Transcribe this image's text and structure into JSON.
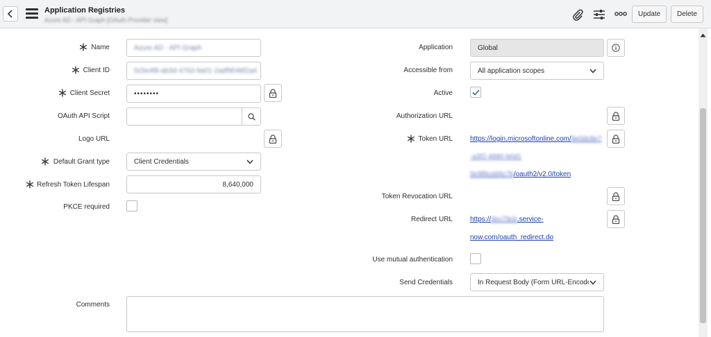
{
  "header": {
    "title": "Application Registries",
    "subtitle": "Azure AD - API Graph [OAuth Provider view]",
    "update_label": "Update",
    "delete_label": "Delete"
  },
  "left": {
    "name_label": "Name",
    "name_value": "Azure AD - API Graph",
    "client_id_label": "Client ID",
    "client_id_value": "0c5e4f8-ab3d-4763-9a01-2adf9048f2a4",
    "client_secret_label": "Client Secret",
    "client_secret_value": "••••••••",
    "oauth_api_script_label": "OAuth API Script",
    "oauth_api_script_value": "",
    "logo_url_label": "Logo URL",
    "default_grant_type_label": "Default Grant type",
    "default_grant_type_value": "Client Credentials",
    "refresh_token_lifespan_label": "Refresh Token Lifespan",
    "refresh_token_lifespan_value": "8,640,000",
    "pkce_required_label": "PKCE required",
    "comments_label": "Comments"
  },
  "right": {
    "application_label": "Application",
    "application_value": "Global",
    "accessible_from_label": "Accessible from",
    "accessible_from_value": "All application scopes",
    "active_label": "Active",
    "authorization_url_label": "Authorization URL",
    "token_url_label": "Token URL",
    "token_url_line1": "https://login.microsoftonline.com/",
    "token_url_blur1": "8e0dc8e7",
    "token_url_blur2": "-a3f2-4880-b0d1",
    "token_url_blur3": "5e9f8cdd4c7b",
    "token_url_line3": "/oauth2/v2.0/token",
    "token_revocation_url_label": "Token Revocation URL",
    "redirect_url_label": "Redirect URL",
    "redirect_url_line1_prefix": "https://",
    "redirect_url_blur": "dev79cb",
    "redirect_url_line1_suffix": ".service-",
    "redirect_url_line2": "now.com/oauth_redirect.do",
    "use_mutual_auth_label": "Use mutual authentication",
    "send_credentials_label": "Send Credentials",
    "send_credentials_value": "In Request Body (Form URL-Encoded)"
  },
  "icons": {
    "back": "chevron-left-icon",
    "menu": "hamburger-menu-icon",
    "attachment": "paperclip-icon",
    "settings": "sliders-icon",
    "more": "more-options-icon",
    "lock": "lock-icon",
    "search": "search-icon",
    "info": "info-icon",
    "check": "checkmark-icon",
    "dropdown": "chevron-down-icon"
  },
  "colors": {
    "header_bg": "#f2f3f4",
    "link": "#1a3fa8",
    "check": "#2d6a7a",
    "readonly_bg": "#e6e6e6"
  }
}
